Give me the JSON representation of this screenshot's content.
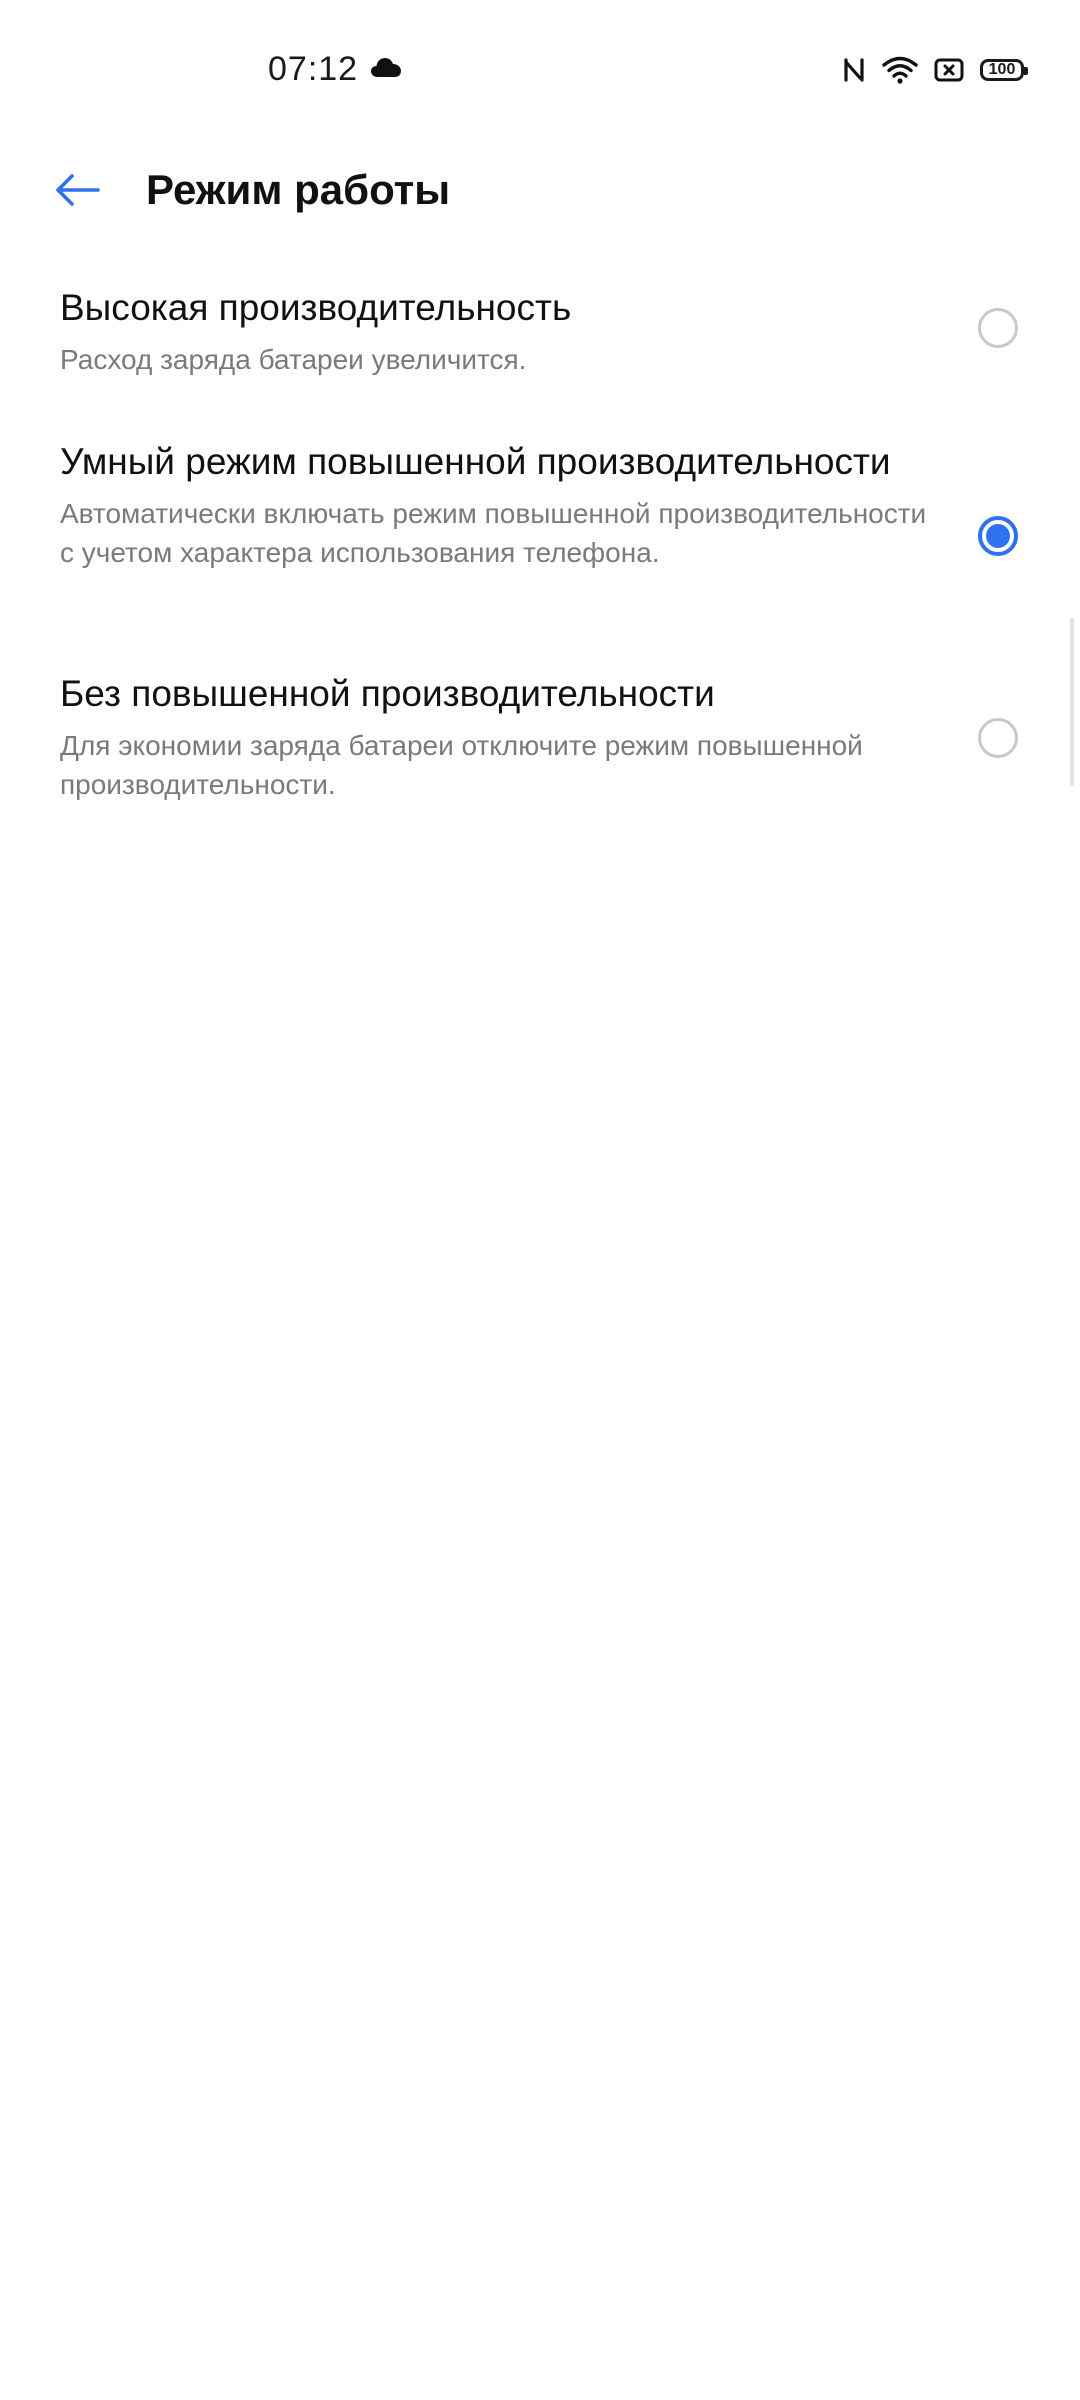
{
  "status_bar": {
    "time": "07:12",
    "battery": "100",
    "icons": [
      "cloud-icon",
      "nfc-icon",
      "wifi-icon",
      "no-sim-icon",
      "battery-icon"
    ]
  },
  "header": {
    "back_icon": "arrow-left-icon",
    "title": "Режим работы"
  },
  "options": [
    {
      "title": "Высокая производительность",
      "description": "Расход заряда батареи увеличится.",
      "selected": false
    },
    {
      "title": "Умный режим повышенной производительности",
      "description": "Автоматически включать режим повышенной производительности с учетом характера использования телефона.",
      "selected": true
    },
    {
      "title": "Без повышенной производительности",
      "description": "Для экономии заряда батареи отключите режим повышенной производительности.",
      "selected": false
    }
  ],
  "colors": {
    "accent": "#2f72ef",
    "radio_unchecked": "#c8c8c8",
    "secondary_text": "#7a7a7a"
  }
}
